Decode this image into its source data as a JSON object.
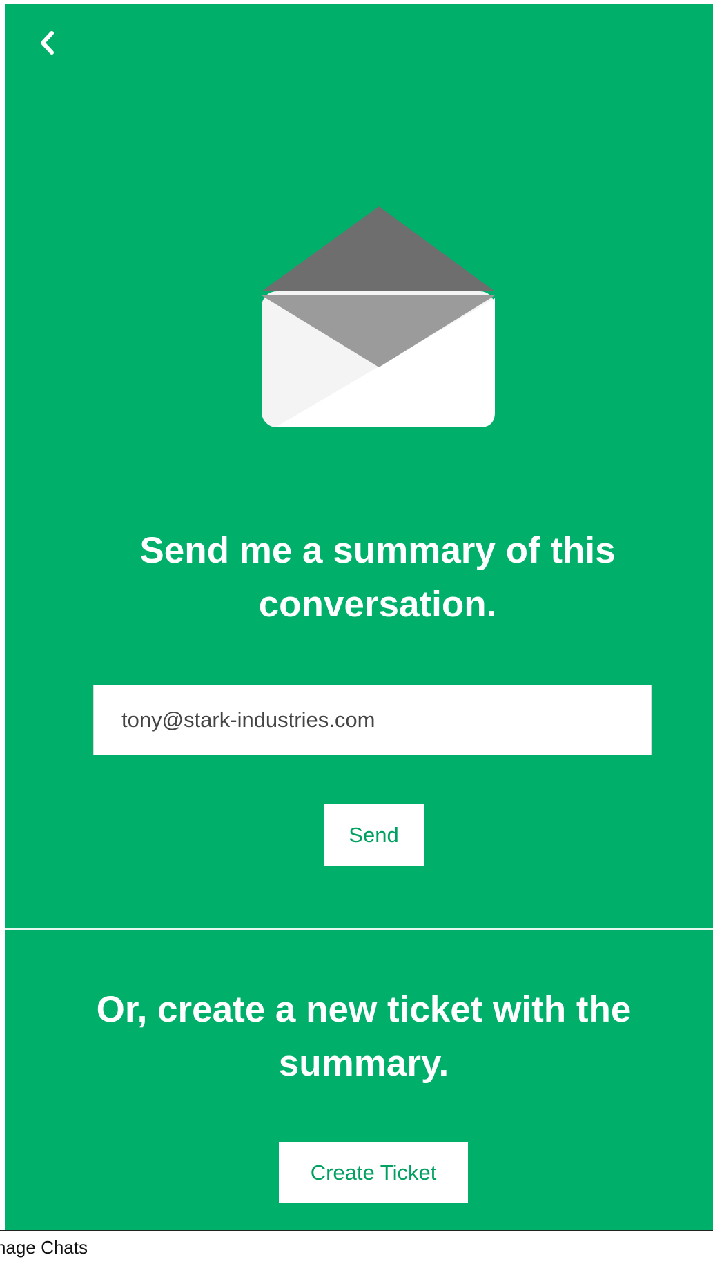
{
  "colors": {
    "background": "#00b06a",
    "accent_text": "#00a060",
    "envelope_dark": "#6e6e6e",
    "envelope_mid": "#9b9b9b",
    "envelope_light": "#f4f4f4"
  },
  "header": {
    "back_icon": "chevron-left-icon"
  },
  "hero": {
    "icon": "open-envelope-icon"
  },
  "summary": {
    "title": "Send me a summary of this conversation.",
    "email_value": "tony@stark-industries.com",
    "send_label": "Send"
  },
  "ticket": {
    "title": "Or, create a new ticket with the summary.",
    "button_label": "Create Ticket"
  },
  "footer": {
    "label": "nage Chats"
  }
}
